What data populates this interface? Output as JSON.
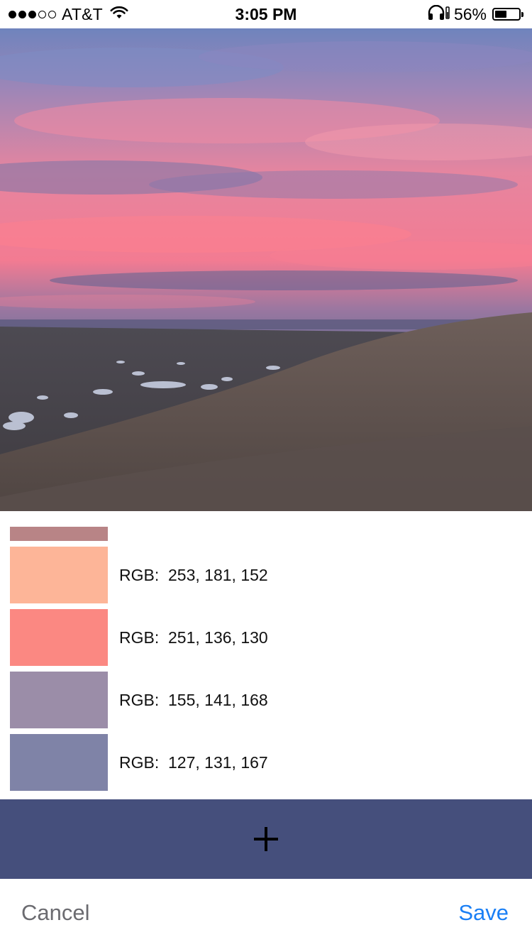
{
  "status_bar": {
    "carrier": "AT&T",
    "time": "3:05 PM",
    "battery_percent": "56%",
    "battery_level": 0.56,
    "signal_bars": 3,
    "signal_total": 5,
    "icons": [
      "signal-dots",
      "wifi-icon",
      "headphones-icon",
      "battery-icon"
    ]
  },
  "photo": {
    "subject": "sunset-over-sand-dunes",
    "colors": {
      "sky_top": "#6f7fb5",
      "cloud_pink": "#f6889a",
      "horizon_purple": "#6a6890",
      "dune_brown": "#5e5350"
    }
  },
  "palette": {
    "partial_swatch_color": "#b88486",
    "swatches": [
      {
        "color": "#fdb598",
        "label": "RGB:  253, 181, 152"
      },
      {
        "color": "#fb8882",
        "label": "RGB:  251, 136, 130"
      },
      {
        "color": "#9b8da8",
        "label": "RGB:  155, 141, 168"
      },
      {
        "color": "#7f83a7",
        "label": "RGB:  127, 131, 167"
      }
    ]
  },
  "add_bar": {
    "color": "#454f7c",
    "icon": "plus-icon"
  },
  "toolbar": {
    "cancel_label": "Cancel",
    "save_label": "Save",
    "save_color": "#1a7ff5"
  }
}
